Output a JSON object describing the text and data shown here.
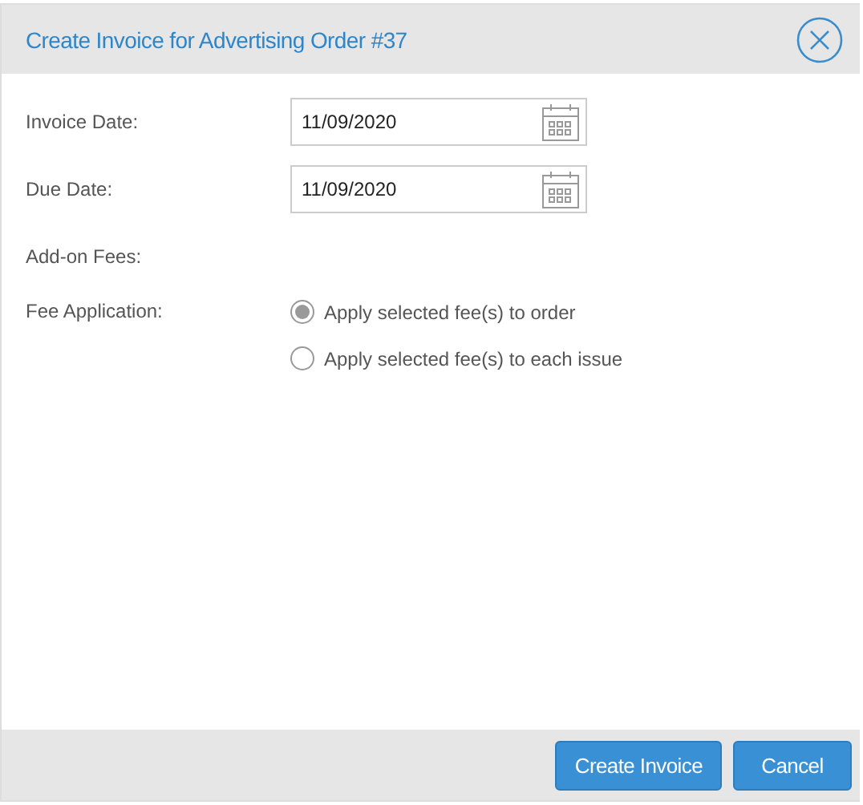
{
  "dialog": {
    "title": "Create Invoice for Advertising Order #37"
  },
  "fields": [
    {
      "label": "Invoice Date:",
      "value": "11/09/2020"
    },
    {
      "label": "Due Date:",
      "value": "11/09/2020"
    }
  ],
  "add_on_fees": {
    "label": "Add-on Fees:"
  },
  "fee_application": {
    "label": "Fee Application:",
    "options": [
      {
        "label": "Apply selected fee(s) to order",
        "selected": true
      },
      {
        "label": "Apply selected fee(s) to each issue",
        "selected": false
      }
    ]
  },
  "buttons": [
    "Create Invoice",
    "Cancel"
  ]
}
